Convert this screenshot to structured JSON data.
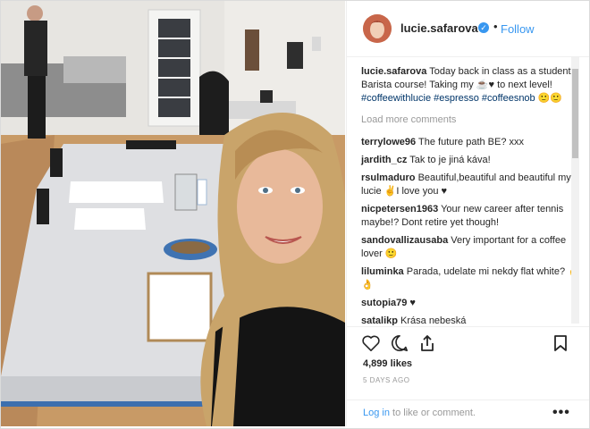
{
  "header": {
    "username": "lucie.safarova",
    "separator": "•",
    "follow_label": "Follow",
    "verified_glyph": "✓"
  },
  "caption": {
    "username": "lucie.safarova",
    "text": " Today back in class as a student! Barista course! Taking my ☕♥ to next level! ",
    "tags": "#coffeewithlucie #espresso #coffeesnob",
    "tail": " 🙂🙂"
  },
  "load_more": "Load more comments",
  "comments": [
    {
      "user": "terrylowe96",
      "text": " The future path BE? xxx"
    },
    {
      "user": "jardith_cz",
      "text": " Tak to je jiná káva!"
    },
    {
      "user": "rsulmaduro",
      "text": " Beautiful,beautiful and beautiful my lucie ✌I love you ♥"
    },
    {
      "user": "nicpetersen1963",
      "text": " Your new career after tennis maybe!? Dont retire yet though!"
    },
    {
      "user": "sandovallizausaba",
      "text": " Very important for a coffee lover 🙂"
    },
    {
      "user": "liluminka",
      "text": " Parada, udelate mi nekdy flat white? ✌👌"
    },
    {
      "user": "sutopia79",
      "text": " ♥"
    },
    {
      "user": "satalikp",
      "text": " Krása nebeská"
    }
  ],
  "icons": {
    "like": "heart-icon",
    "comment": "comment-icon",
    "share": "share-icon",
    "save": "bookmark-icon",
    "more": "more-options-icon"
  },
  "likes": "4,899 likes",
  "time_ago": "5 DAYS AGO",
  "footer": {
    "login_link": "Log in",
    "login_text": " to like or comment.",
    "more_glyph": "•••"
  },
  "colors": {
    "link": "#3897f0",
    "hashtag": "#003569",
    "muted": "#999999",
    "text": "#262626"
  }
}
